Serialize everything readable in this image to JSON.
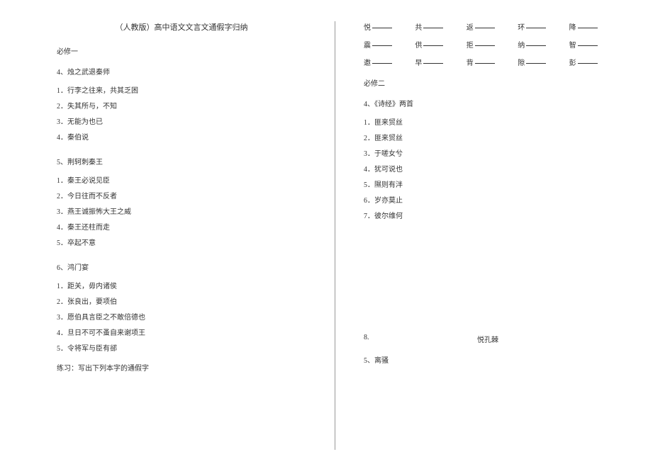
{
  "title": "（人教版）高中语文文言文通假字归纳",
  "left": {
    "sec1": "必修一",
    "l4": "4、烛之武退秦师",
    "l4_items": [
      "1．行李之往来，共其乏困",
      "2．失其所与，不知",
      "3．无能为也已",
      "4．秦伯说"
    ],
    "l5": "5、荆轲刺秦王",
    "l5_items": [
      "1．秦王必说见臣",
      "2．今日往而不反者",
      "3．燕王诚振怖大王之威",
      "4．秦王还柱而走",
      "5．卒起不意"
    ],
    "l6": "6、鸿门宴",
    "l6_items": [
      "1．距关，毋内诸侯",
      "2．张良出，要项伯",
      "3．愿伯具言臣之不敢倍德也",
      "4．旦日不可不蚤自来谢项王",
      "5．令将军与臣有郤"
    ],
    "practice": "练习：写出下列本字的通假字"
  },
  "right": {
    "grid": [
      "悦",
      "共",
      "返",
      "环",
      "降",
      "震",
      "供",
      "拒",
      "纳",
      "智",
      "邀",
      "早",
      "背",
      "隙",
      "彭"
    ],
    "sec2": "必修二",
    "l4b": "4、《诗经》两首",
    "l4b_items": [
      "1．匪来贸丝",
      "2．匪来贸丝",
      "3．于嗟女兮",
      "4．犹可说也",
      "5．隰则有泮",
      "6．岁亦莫止",
      "7．彼尔维何"
    ],
    "line8_num": "8.",
    "line8_txt": "悦孔棘",
    "l5b": "5、离骚"
  }
}
